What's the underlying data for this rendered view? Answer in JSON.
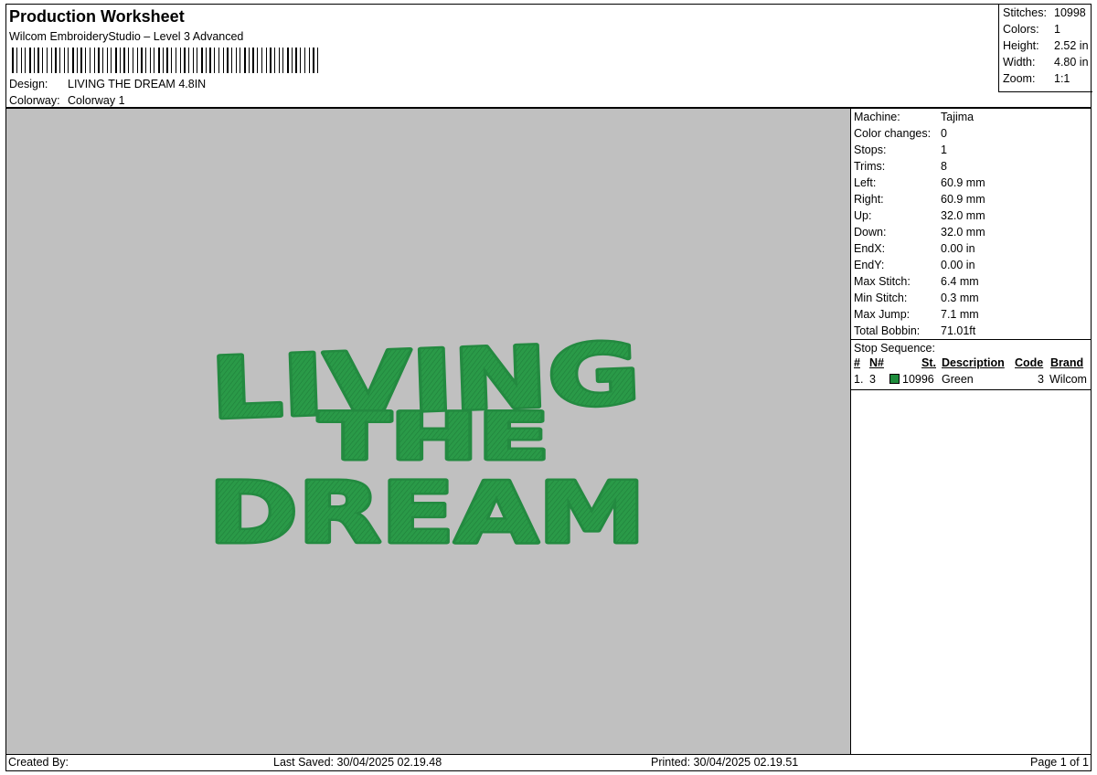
{
  "header": {
    "title": "Production Worksheet",
    "subtitle": "Wilcom EmbroideryStudio – Level 3 Advanced",
    "design_label": "Design:",
    "design_value": "LIVING THE DREAM 4.8IN",
    "colorway_label": "Colorway:",
    "colorway_value": "Colorway 1"
  },
  "stats": {
    "stitches_label": "Stitches:",
    "stitches_value": "10998",
    "colors_label": "Colors:",
    "colors_value": "1",
    "height_label": "Height:",
    "height_value": "2.52 in",
    "width_label": "Width:",
    "width_value": "4.80 in",
    "zoom_label": "Zoom:",
    "zoom_value": "1:1"
  },
  "design_preview": {
    "lines": [
      "LIVING",
      "THE",
      "DREAM"
    ],
    "thread_color": "#2a9a48",
    "background_color": "#c0c0c0"
  },
  "info": {
    "machine_label": "Machine:",
    "machine_value": "Tajima",
    "color_changes_label": "Color changes:",
    "color_changes_value": "0",
    "stops_label": "Stops:",
    "stops_value": "1",
    "trims_label": "Trims:",
    "trims_value": "8",
    "left_label": "Left:",
    "left_value": "60.9 mm",
    "right_label": "Right:",
    "right_value": "60.9 mm",
    "up_label": "Up:",
    "up_value": "32.0 mm",
    "down_label": "Down:",
    "down_value": "32.0 mm",
    "endx_label": "EndX:",
    "endx_value": "0.00 in",
    "endy_label": "EndY:",
    "endy_value": "0.00 in",
    "max_stitch_label": "Max Stitch:",
    "max_stitch_value": "6.4 mm",
    "min_stitch_label": "Min Stitch:",
    "min_stitch_value": "0.3 mm",
    "max_jump_label": "Max Jump:",
    "max_jump_value": "7.1 mm",
    "total_bobbin_label": "Total Bobbin:",
    "total_bobbin_value": "71.01ft"
  },
  "stop_sequence": {
    "title": "Stop Sequence:",
    "headers": {
      "num": "#",
      "n": "N#",
      "st": "St.",
      "description": "Description",
      "code": "Code",
      "brand": "Brand"
    },
    "row": {
      "num": "1.",
      "n": "3",
      "st": "10996",
      "description": "Green",
      "code": "3",
      "brand": "Wilcom",
      "color": "#1e8c3c"
    }
  },
  "footer": {
    "created_by": "Created By:",
    "last_saved": "Last Saved: 30/04/2025 02.19.48",
    "printed": "Printed: 30/04/2025 02.19.51",
    "page": "Page 1 of 1"
  }
}
